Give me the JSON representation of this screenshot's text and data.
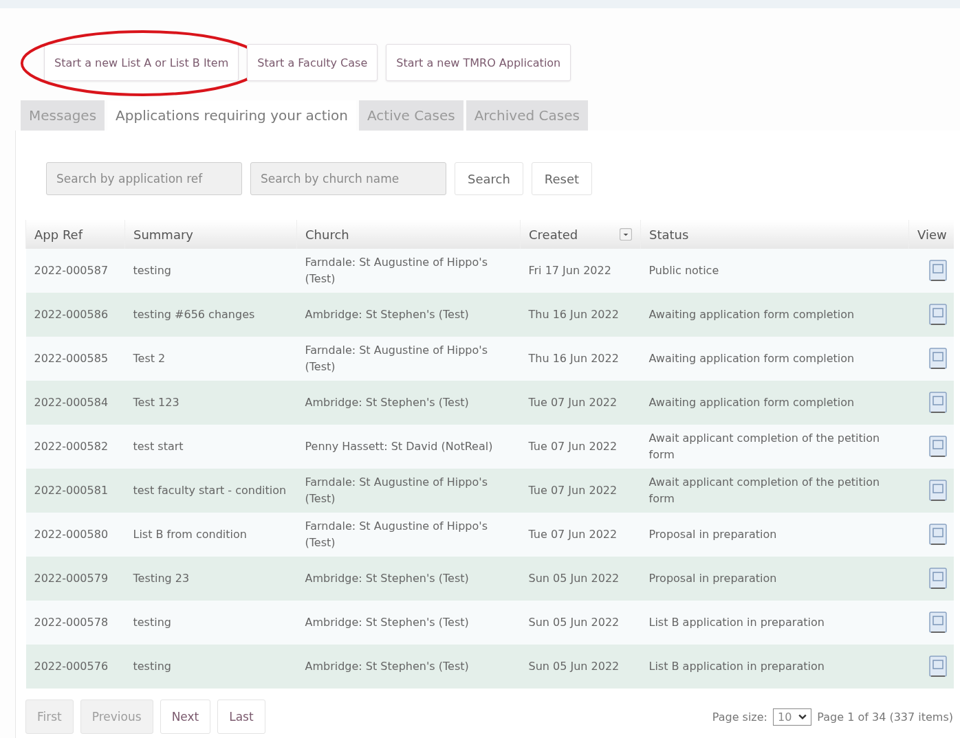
{
  "action_buttons": [
    {
      "label": "Start a new List A or List B Item",
      "highlighted": true
    },
    {
      "label": "Start a Faculty Case",
      "highlighted": false
    },
    {
      "label": "Start a new TMRO Application",
      "highlighted": false
    }
  ],
  "tabs": [
    {
      "label": "Messages",
      "selected": false
    },
    {
      "label": "Applications requiring your action",
      "selected": true
    },
    {
      "label": "Active Cases",
      "selected": false
    },
    {
      "label": "Archived Cases",
      "selected": false
    }
  ],
  "search": {
    "ref_placeholder": "Search by application ref",
    "church_placeholder": "Search by church name",
    "buttons": [
      "Search",
      "Reset"
    ]
  },
  "table": {
    "columns": [
      "App Ref",
      "Summary",
      "Church",
      "Created",
      "Status",
      "View"
    ],
    "rows": [
      {
        "app_ref": "2022-000587",
        "summary": "testing",
        "church": "Farndale: St Augustine of Hippo's (Test)",
        "created": "Fri 17 Jun 2022",
        "status": "Public notice"
      },
      {
        "app_ref": "2022-000586",
        "summary": "testing #656 changes",
        "church": "Ambridge: St Stephen's (Test)",
        "created": "Thu 16 Jun 2022",
        "status": "Awaiting application form completion"
      },
      {
        "app_ref": "2022-000585",
        "summary": "Test 2",
        "church": "Farndale: St Augustine of Hippo's (Test)",
        "created": "Thu 16 Jun 2022",
        "status": "Awaiting application form completion"
      },
      {
        "app_ref": "2022-000584",
        "summary": "Test 123",
        "church": "Ambridge: St Stephen's (Test)",
        "created": "Tue 07 Jun 2022",
        "status": "Awaiting application form completion"
      },
      {
        "app_ref": "2022-000582",
        "summary": "test start",
        "church": "Penny Hassett: St David (NotReal)",
        "created": "Tue 07 Jun 2022",
        "status": "Await applicant completion of the petition form"
      },
      {
        "app_ref": "2022-000581",
        "summary": "test faculty start - condition",
        "church": "Farndale: St Augustine of Hippo's (Test)",
        "created": "Tue 07 Jun 2022",
        "status": "Await applicant completion of the petition form"
      },
      {
        "app_ref": "2022-000580",
        "summary": "List B from condition",
        "church": "Farndale: St Augustine of Hippo's (Test)",
        "created": "Tue 07 Jun 2022",
        "status": "Proposal in preparation"
      },
      {
        "app_ref": "2022-000579",
        "summary": "Testing 23",
        "church": "Ambridge: St Stephen's (Test)",
        "created": "Sun 05 Jun 2022",
        "status": "Proposal in preparation"
      },
      {
        "app_ref": "2022-000578",
        "summary": "testing",
        "church": "Ambridge: St Stephen's (Test)",
        "created": "Sun 05 Jun 2022",
        "status": "List B application in preparation"
      },
      {
        "app_ref": "2022-000576",
        "summary": "testing",
        "church": "Ambridge: St Stephen's (Test)",
        "created": "Sun 05 Jun 2022",
        "status": "List B application in preparation"
      }
    ]
  },
  "pager": {
    "buttons": [
      {
        "label": "First",
        "disabled": true
      },
      {
        "label": "Previous",
        "disabled": true
      },
      {
        "label": "Next",
        "disabled": false
      },
      {
        "label": "Last",
        "disabled": false
      }
    ],
    "page_size_label": "Page size:",
    "page_size": "10",
    "page_info": "Page 1 of 34 (337 items)"
  }
}
